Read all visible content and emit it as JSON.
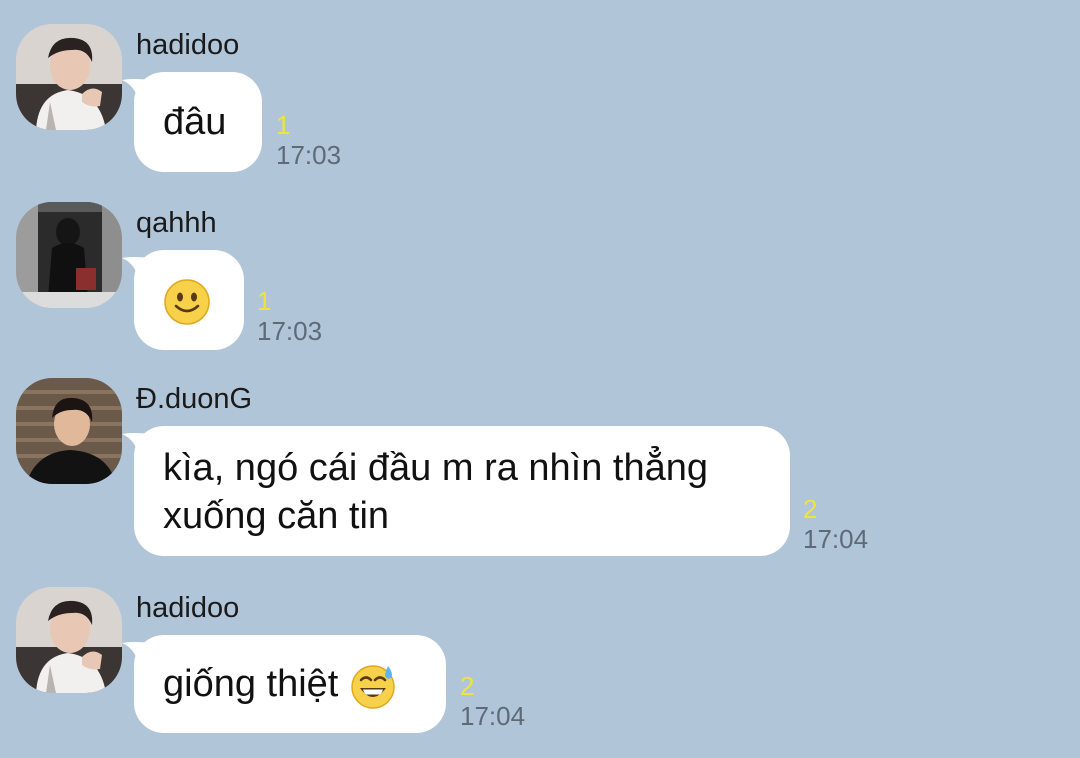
{
  "messages": [
    {
      "sender": "hadidoo",
      "text": "đâu",
      "unread": "1",
      "time": "17:03",
      "avatar_icon": "profile-photo"
    },
    {
      "sender": "qahhh",
      "text": "",
      "emoji": "slightly-smiling-face",
      "unread": "1",
      "time": "17:03",
      "avatar_icon": "profile-photo"
    },
    {
      "sender": "Đ.duonG",
      "line1": "kìa, ngó cái đầu m ra nhìn thẳng",
      "line2": "xuống căn tin",
      "unread": "2",
      "time": "17:04",
      "avatar_icon": "profile-photo"
    },
    {
      "sender": "hadidoo",
      "text": "giống thiệt",
      "emoji": "grinning-face-with-sweat",
      "unread": "2",
      "time": "17:04",
      "avatar_icon": "profile-photo"
    }
  ],
  "colors": {
    "background": "#b1c5d9",
    "bubble": "#ffffff",
    "unread": "#efe53a",
    "time": "#5d6b78"
  }
}
